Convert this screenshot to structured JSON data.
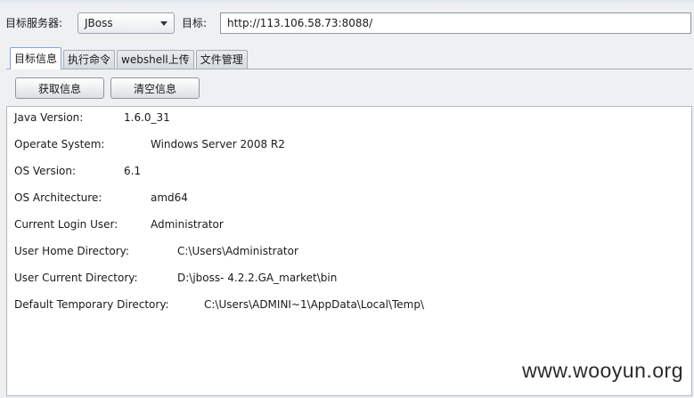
{
  "target": {
    "server_label": "目标服务器:",
    "server_value": "JBoss",
    "target_label": "目标:",
    "url": "http://113.106.58.73:8088/"
  },
  "tabs": [
    {
      "label": "目标信息",
      "active": true
    },
    {
      "label": "执行命令",
      "active": false
    },
    {
      "label": "webshell上传",
      "active": false
    },
    {
      "label": "文件管理",
      "active": false
    }
  ],
  "buttons": {
    "get_info": "获取信息",
    "clear_info": "清空信息"
  },
  "info": [
    {
      "key": "Java Version:",
      "value": "1.6.0_31"
    },
    {
      "key": "Operate System:",
      "value": "Windows Server 2008 R2"
    },
    {
      "key": "OS Version:",
      "value": "6.1"
    },
    {
      "key": "OS Architecture:",
      "value": "amd64"
    },
    {
      "key": "Current Login User:",
      "value": "Administrator"
    },
    {
      "key": "User Home Directory:",
      "value": "C:\\Users\\Administrator"
    },
    {
      "key": "User Current Directory:",
      "value": "D:\\jboss- 4.2.2.GA_market\\bin"
    },
    {
      "key": "Default Temporary Directory:",
      "value": "C:\\Users\\ADMINI~1\\AppData\\Local\\Temp\\"
    }
  ],
  "watermark": "www.wooyun.org"
}
